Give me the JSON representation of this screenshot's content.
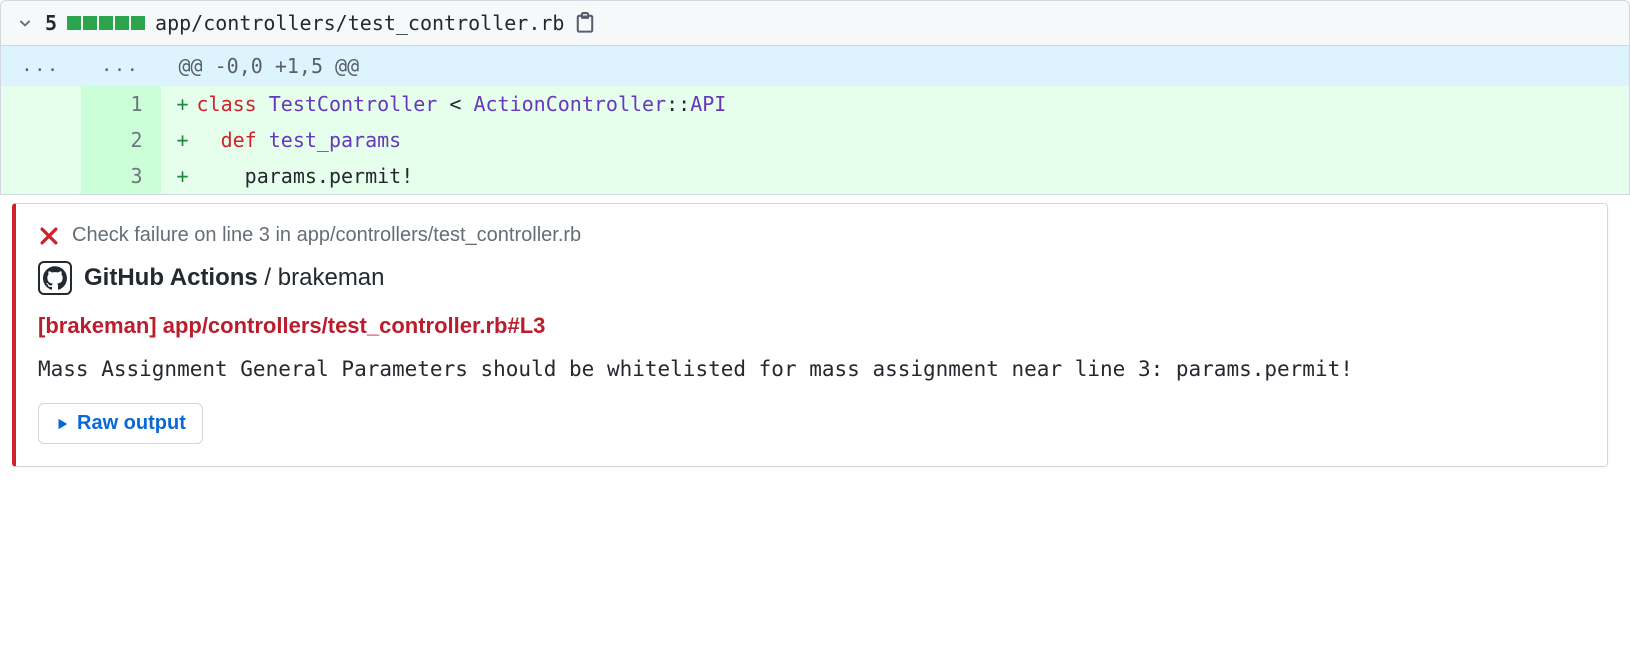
{
  "file": {
    "change_count": "5",
    "diffstat_blocks": 5,
    "path": "app/controllers/test_controller.rb"
  },
  "hunk": {
    "header": "@@ -0,0 +1,5 @@",
    "lines": [
      {
        "old": "",
        "new": "1",
        "marker": "+",
        "segments": [
          {
            "cls": "tok-class",
            "t": "class"
          },
          {
            "cls": "",
            "t": " "
          },
          {
            "cls": "tok-type",
            "t": "TestController"
          },
          {
            "cls": "",
            "t": " < "
          },
          {
            "cls": "tok-type",
            "t": "ActionController"
          },
          {
            "cls": "",
            "t": "::"
          },
          {
            "cls": "tok-type",
            "t": "API"
          }
        ]
      },
      {
        "old": "",
        "new": "2",
        "marker": "+",
        "segments": [
          {
            "cls": "",
            "t": "  "
          },
          {
            "cls": "tok-def",
            "t": "def"
          },
          {
            "cls": "",
            "t": " "
          },
          {
            "cls": "tok-name",
            "t": "test_params"
          }
        ]
      },
      {
        "old": "",
        "new": "3",
        "marker": "+",
        "segments": [
          {
            "cls": "",
            "t": "    "
          },
          {
            "cls": "tok-call",
            "t": "params.permit!"
          }
        ]
      }
    ]
  },
  "annotation": {
    "summary": "Check failure on line 3 in app/controllers/test_controller.rb",
    "source_bold": "GitHub Actions",
    "source_sep": " / ",
    "source_rest": "brakeman",
    "title": "[brakeman] app/controllers/test_controller.rb#L3",
    "body": "Mass Assignment General Parameters should be whitelisted for mass assignment near line 3: params.permit!",
    "raw_output_label": "Raw output"
  }
}
